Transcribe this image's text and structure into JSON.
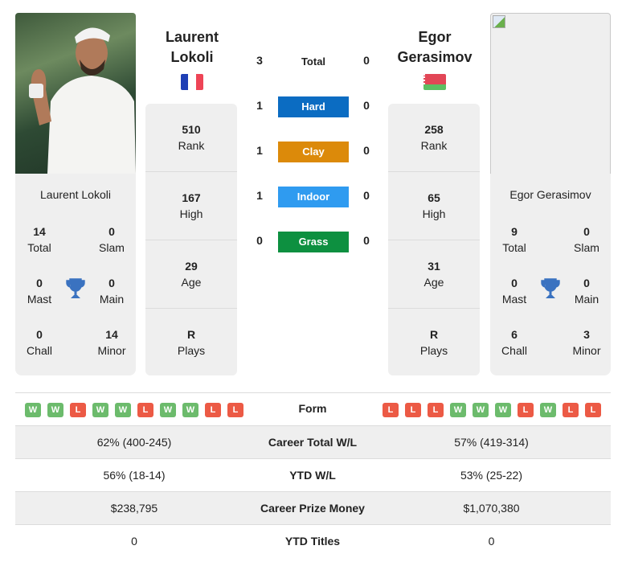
{
  "player1": {
    "name_line1": "Laurent",
    "name_line2": "Lokoli",
    "full_name": "Laurent Lokoli",
    "flag": "france-flag",
    "rank": {
      "value": "510",
      "label": "Rank"
    },
    "high": {
      "value": "167",
      "label": "High"
    },
    "age": {
      "value": "29",
      "label": "Age"
    },
    "plays": {
      "value": "R",
      "label": "Plays"
    },
    "titles": {
      "total": {
        "value": "14",
        "label": "Total"
      },
      "slam": {
        "value": "0",
        "label": "Slam"
      },
      "mast": {
        "value": "0",
        "label": "Mast"
      },
      "main": {
        "value": "0",
        "label": "Main"
      },
      "chall": {
        "value": "0",
        "label": "Chall"
      },
      "minor": {
        "value": "14",
        "label": "Minor"
      }
    },
    "form": [
      "W",
      "W",
      "L",
      "W",
      "W",
      "L",
      "W",
      "W",
      "L",
      "L"
    ]
  },
  "player2": {
    "name_line1": "Egor",
    "name_line2": "Gerasimov",
    "full_name": "Egor Gerasimov",
    "flag": "belarus-flag",
    "rank": {
      "value": "258",
      "label": "Rank"
    },
    "high": {
      "value": "65",
      "label": "High"
    },
    "age": {
      "value": "31",
      "label": "Age"
    },
    "plays": {
      "value": "R",
      "label": "Plays"
    },
    "titles": {
      "total": {
        "value": "9",
        "label": "Total"
      },
      "slam": {
        "value": "0",
        "label": "Slam"
      },
      "mast": {
        "value": "0",
        "label": "Mast"
      },
      "main": {
        "value": "0",
        "label": "Main"
      },
      "chall": {
        "value": "6",
        "label": "Chall"
      },
      "minor": {
        "value": "3",
        "label": "Minor"
      }
    },
    "form": [
      "L",
      "L",
      "L",
      "W",
      "W",
      "W",
      "L",
      "W",
      "L",
      "L"
    ]
  },
  "h2h": {
    "total": {
      "label": "Total",
      "p1": "3",
      "p2": "0"
    },
    "surfaces": [
      {
        "label": "Hard",
        "p1": "1",
        "p2": "0",
        "color": "#0b6cc2"
      },
      {
        "label": "Clay",
        "p1": "1",
        "p2": "0",
        "color": "#dc8a0a"
      },
      {
        "label": "Indoor",
        "p1": "1",
        "p2": "0",
        "color": "#2f9bf0"
      },
      {
        "label": "Grass",
        "p1": "0",
        "p2": "0",
        "color": "#0d9040"
      }
    ]
  },
  "comparison": {
    "form_label": "Form",
    "rows": [
      {
        "label": "Career Total W/L",
        "p1": "62% (400-245)",
        "p2": "57% (419-314)"
      },
      {
        "label": "YTD W/L",
        "p1": "56% (18-14)",
        "p2": "53% (25-22)"
      },
      {
        "label": "Career Prize Money",
        "p1": "$238,795",
        "p2": "$1,070,380"
      },
      {
        "label": "YTD Titles",
        "p1": "0",
        "p2": "0"
      }
    ]
  }
}
